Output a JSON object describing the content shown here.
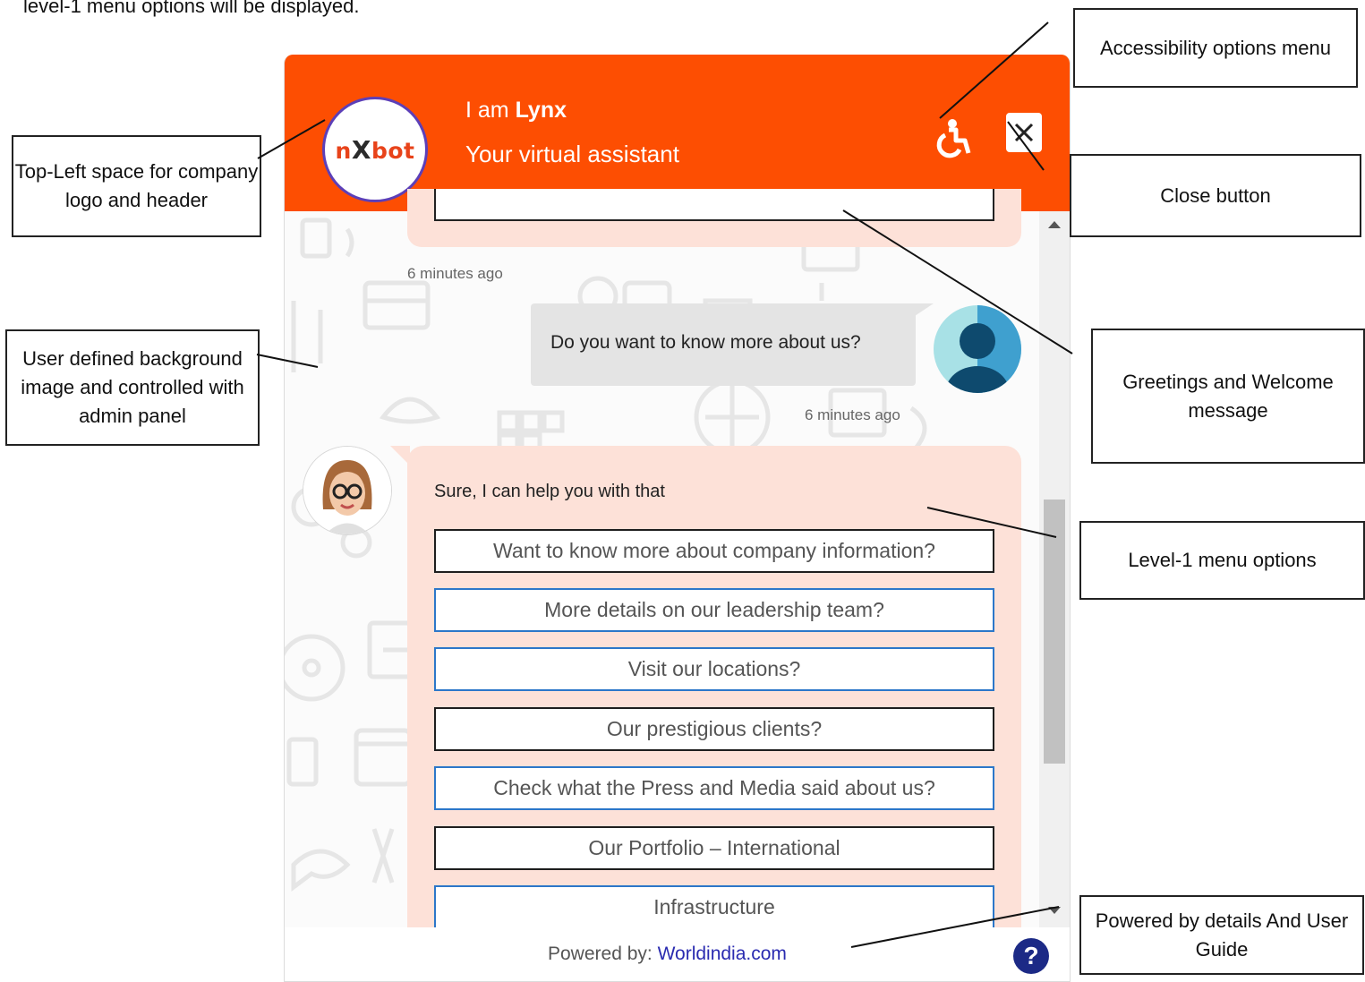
{
  "caption": "level-1 menu options will be displayed.",
  "header": {
    "logo_text": "nXbot",
    "line1_prefix": "I am ",
    "bot_name": "Lynx",
    "line2": "Your virtual assistant"
  },
  "chat": {
    "prev_timestamp": "6 minutes ago",
    "user_message": "Do you want to know more about us?",
    "user_timestamp": "6 minutes ago",
    "bot_message": "Sure, I can help you with that",
    "options": [
      "Want to know more about company information?",
      "More details on our leadership team?",
      "Visit our locations?",
      "Our prestigious clients?",
      "Check what the Press and Media said about us?",
      "Our Portfolio – International",
      "Infrastructure"
    ]
  },
  "footer": {
    "powered_label": "Powered by: ",
    "powered_link": "Worldindia.com",
    "help_symbol": "?"
  },
  "annotations": {
    "logo": "Top-Left space for company logo and header",
    "background": "User defined background image and controlled with admin panel",
    "accessibility": "Accessibility options menu",
    "close": "Close button",
    "greetings": "Greetings and Welcome message",
    "level1": "Level-1 menu options",
    "powered": "Powered by details And User Guide"
  },
  "colors": {
    "header": "#fd4e02",
    "bot_bubble": "#fde1d8",
    "user_bubble": "#e4e4e4",
    "link": "#2a2bb0",
    "help": "#1c2a86"
  }
}
